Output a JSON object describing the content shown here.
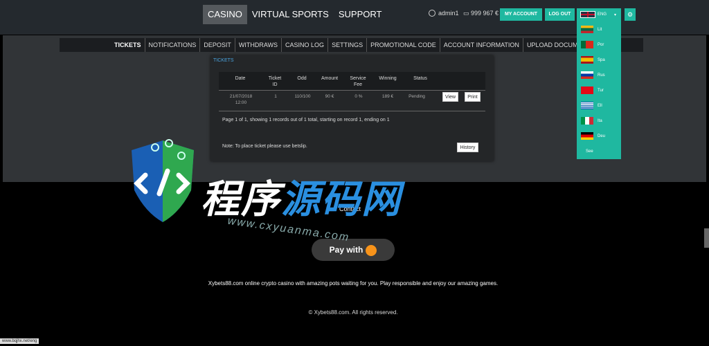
{
  "header": {
    "nav": [
      "CASINO",
      "VIRTUAL SPORTS",
      "SUPPORT"
    ],
    "username": "admin1",
    "balance": "999 967 €",
    "my_account": "MY ACCOUNT",
    "logout": "LOG OUT",
    "lang_current": "ENG"
  },
  "lang_menu": [
    "Lit",
    "Por",
    "Spa",
    "Rus",
    "Tur",
    "Ell",
    "Ita",
    "Deu"
  ],
  "lang_more": "See",
  "subnav": [
    "TICKETS",
    "NOTIFICATIONS",
    "DEPOSIT",
    "WITHDRAWS",
    "CASINO LOG",
    "SETTINGS",
    "PROMOTIONAL CODE",
    "ACCOUNT INFORMATION",
    "UPLOAD DOCUMENTAT"
  ],
  "tickets": {
    "title": "TICKETS",
    "headers": [
      "Date",
      "Ticket ID",
      "Odd",
      "Amount",
      "Service Fee",
      "Winning",
      "Status"
    ],
    "row": {
      "date": "21/07/2018 12:00",
      "id": "1",
      "odd": "110/100",
      "amount": "90 €",
      "fee": "0 %",
      "winning": "189 €",
      "status": "Pending",
      "view": "View",
      "print": "Print"
    },
    "pagination": "Page 1 of 1, showing 1 records out of 1 total, starting on record 1, ending on 1",
    "note": "Note: To place ticket please use betslip.",
    "history": "History"
  },
  "footer": {
    "contact": "Contact",
    "pay": "Pay with",
    "text": "Xybets88.com online crypto casino with amazing pots waiting for you. Play responsible and enjoy our amazing games.",
    "copyright": "© Xybets88.com. All rights reserved."
  },
  "status_url": "www.bqjhx.net/eng",
  "watermark": {
    "cn_white": "程序",
    "cn_blue": "源码网",
    "url": "www.cxyuanma.com"
  },
  "colors": {
    "accent": "#1fb8a0",
    "title_blue": "#4aa3df"
  }
}
